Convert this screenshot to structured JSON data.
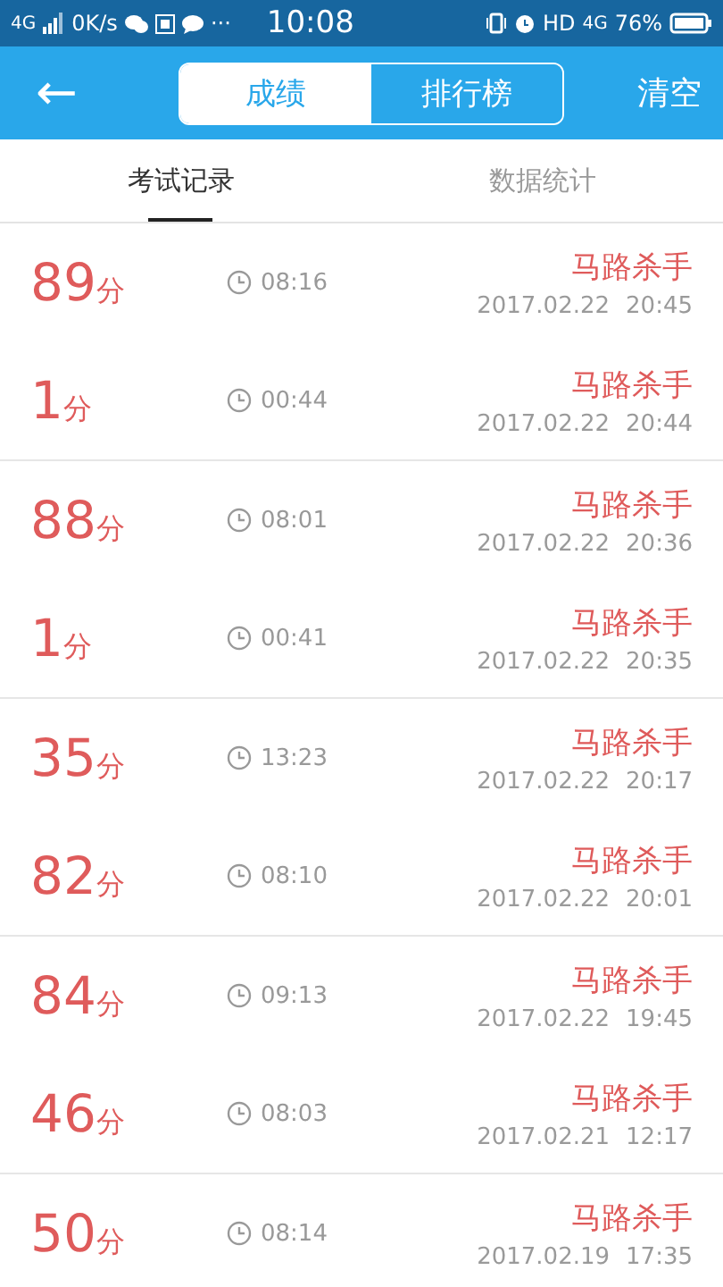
{
  "status_bar": {
    "network": "4G",
    "speed": "0K/s",
    "more": "···",
    "time": "10:08",
    "hd": "HD",
    "network_2": "4G",
    "battery": "76%"
  },
  "header": {
    "back": "←",
    "segments": [
      {
        "label": "成绩",
        "selected": true
      },
      {
        "label": "排行榜",
        "selected": false
      }
    ],
    "action": "清空"
  },
  "tabs": [
    {
      "label": "考试记录",
      "selected": true
    },
    {
      "label": "数据统计",
      "selected": false
    }
  ],
  "records": [
    {
      "score": "89",
      "unit": "分",
      "duration": "08:16",
      "name": "马路杀手",
      "date": "2017.02.22",
      "time": "20:45"
    },
    {
      "score": "1",
      "unit": "分",
      "duration": "00:44",
      "name": "马路杀手",
      "date": "2017.02.22",
      "time": "20:44"
    },
    {
      "score": "88",
      "unit": "分",
      "duration": "08:01",
      "name": "马路杀手",
      "date": "2017.02.22",
      "time": "20:36"
    },
    {
      "score": "1",
      "unit": "分",
      "duration": "00:41",
      "name": "马路杀手",
      "date": "2017.02.22",
      "time": "20:35"
    },
    {
      "score": "35",
      "unit": "分",
      "duration": "13:23",
      "name": "马路杀手",
      "date": "2017.02.22",
      "time": "20:17"
    },
    {
      "score": "82",
      "unit": "分",
      "duration": "08:10",
      "name": "马路杀手",
      "date": "2017.02.22",
      "time": "20:01"
    },
    {
      "score": "84",
      "unit": "分",
      "duration": "09:13",
      "name": "马路杀手",
      "date": "2017.02.22",
      "time": "19:45"
    },
    {
      "score": "46",
      "unit": "分",
      "duration": "08:03",
      "name": "马路杀手",
      "date": "2017.02.21",
      "time": "12:17"
    },
    {
      "score": "50",
      "unit": "分",
      "duration": "08:14",
      "name": "马路杀手",
      "date": "2017.02.19",
      "time": "17:35"
    }
  ]
}
